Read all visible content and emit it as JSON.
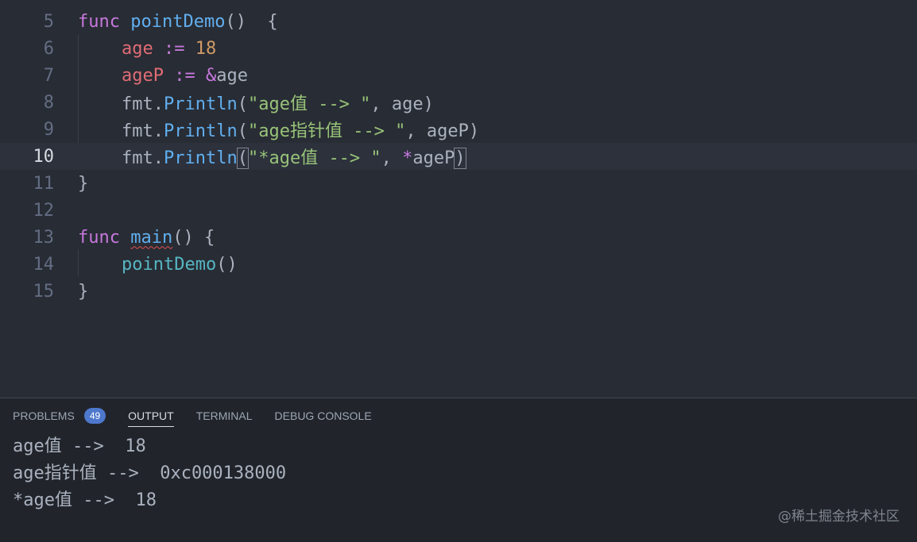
{
  "editor": {
    "lines": [
      {
        "num": "5",
        "current": false
      },
      {
        "num": "6",
        "current": false
      },
      {
        "num": "7",
        "current": false
      },
      {
        "num": "8",
        "current": false
      },
      {
        "num": "9",
        "current": false
      },
      {
        "num": "10",
        "current": true
      },
      {
        "num": "11",
        "current": false
      },
      {
        "num": "12",
        "current": false
      },
      {
        "num": "13",
        "current": false
      },
      {
        "num": "14",
        "current": false
      },
      {
        "num": "15",
        "current": false
      }
    ],
    "tokens": {
      "func": "func",
      "pointDemo": "pointDemo",
      "open_sig": "()  {",
      "age": "age",
      "assign": ":=",
      "eighteen": "18",
      "ageP": "ageP",
      "amp": "&",
      "age2": "age",
      "fmt": "fmt",
      "dot": ".",
      "println": "Println",
      "lp": "(",
      "str1": "\"age值 --> \"",
      "args1": ", age)",
      "str2": "\"age指针值 --> \"",
      "args2": ", ageP)",
      "str3": "\"*age值 --> \"",
      "comma": ", ",
      "star": "*",
      "ageP2": "ageP",
      "rp": ")",
      "close": "}",
      "main": "main",
      "main_sig": "() {",
      "call": "pointDemo",
      "call_parens": "()"
    }
  },
  "panel": {
    "tabs": [
      {
        "label": "PROBLEMS",
        "badge": "49"
      },
      {
        "label": "OUTPUT"
      },
      {
        "label": "TERMINAL"
      },
      {
        "label": "DEBUG CONSOLE"
      }
    ],
    "output": [
      "age值 -->  18",
      "age指针值 -->  0xc000138000",
      "*age值 -->  18"
    ]
  },
  "watermark": "@稀土掘金技术社区"
}
